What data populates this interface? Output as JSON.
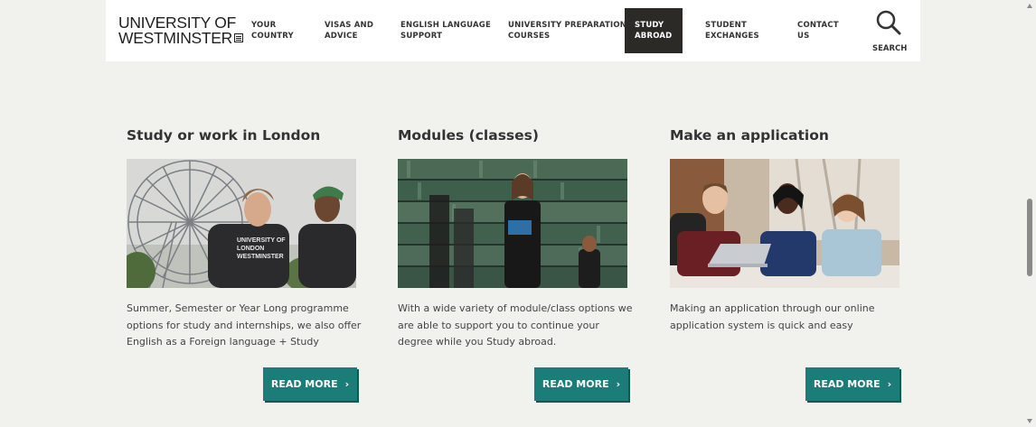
{
  "header": {
    "logo_line1": "UNIVERSITY OF",
    "logo_line2": "WESTMINSTER",
    "nav": [
      {
        "line1": "YOUR",
        "line2": "COUNTRY"
      },
      {
        "line1": "VISAS AND",
        "line2": "ADVICE"
      },
      {
        "line1": "ENGLISH LANGUAGE",
        "line2": "SUPPORT"
      },
      {
        "line1": "UNIVERSITY PREPARATION",
        "line2": "COURSES"
      },
      {
        "line1": "STUDY",
        "line2": "ABROAD"
      },
      {
        "line1": "STUDENT",
        "line2": "EXCHANGES"
      },
      {
        "line1": "CONTACT",
        "line2": "US"
      }
    ],
    "active_nav": "STUDY ABROAD",
    "search_label": "SEARCH"
  },
  "cards": [
    {
      "title": "Study or work in London",
      "text": "Summer, Semester or Year Long programme options for study and internships, we also offer English as a Foreign language + Study",
      "image": "students-london-eye-photo",
      "shirt_line1": "UNIVERSITY OF",
      "shirt_line2": "LONDON",
      "shirt_line3": "WESTMINSTER",
      "button": "READ MORE"
    },
    {
      "title": "Modules (classes)",
      "text": "With a wide variety of module/class options we are able to support you to continue your degree while you Study abroad.",
      "image": "library-students-photo",
      "button": "READ MORE"
    },
    {
      "title": "Make an application",
      "text": "Making an application through our online application system is quick and easy",
      "image": "students-laptop-photo",
      "button": "READ MORE"
    }
  ],
  "colors": {
    "page_bg": "#f1f1ee",
    "header_bg": "#ffffff",
    "active_nav_bg": "#2c2a27",
    "button_bg": "#1c7c77"
  }
}
